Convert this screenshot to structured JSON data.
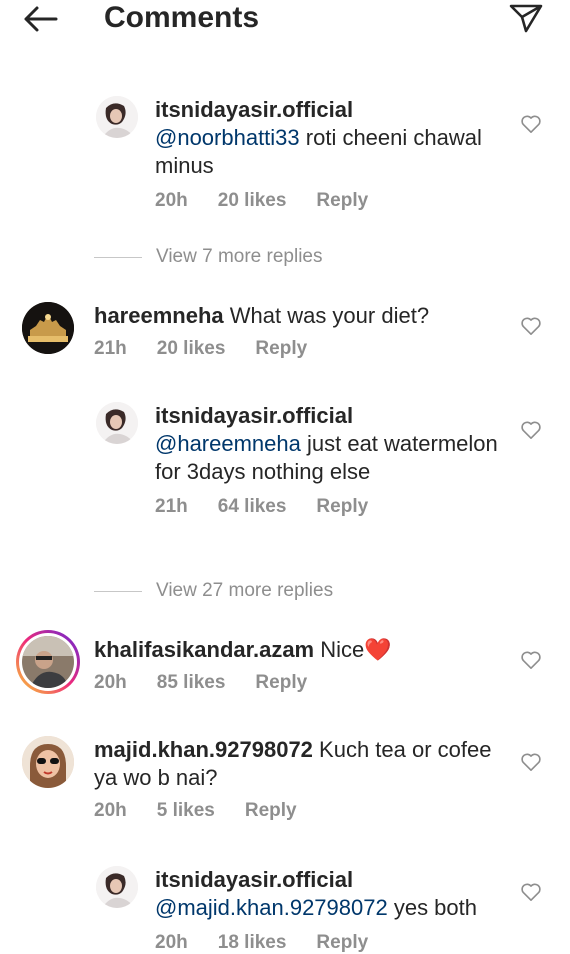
{
  "header": {
    "title": "Comments"
  },
  "comments": [
    {
      "user": "itsnidayasir.official",
      "mention": "@noorbhatti33",
      "text": " roti cheeni chawal minus",
      "time": "20h",
      "likes": "20 likes",
      "reply": "Reply"
    },
    {
      "user": "hareemneha",
      "text": " What was your diet?",
      "time": "21h",
      "likes": "20 likes",
      "reply": "Reply"
    },
    {
      "user": "itsnidayasir.official",
      "mention": "@hareemneha",
      "text": " just eat watermelon for 3days nothing else",
      "time": "21h",
      "likes": "64 likes",
      "reply": "Reply"
    },
    {
      "user": "khalifasikandar.azam",
      "text": " Nice",
      "emoji": "❤️",
      "time": "20h",
      "likes": "85 likes",
      "reply": "Reply"
    },
    {
      "user": "majid.khan.92798072",
      "text": " Kuch tea or cofee ya wo b nai?",
      "time": "20h",
      "likes": "5 likes",
      "reply": "Reply"
    },
    {
      "user": "itsnidayasir.official",
      "mention": "@majid.khan.92798072",
      "text": " yes both",
      "time": "20h",
      "likes": "18 likes",
      "reply": "Reply"
    }
  ],
  "view_more": [
    {
      "label": "View 7 more replies"
    },
    {
      "label": "View 27 more replies"
    }
  ],
  "colors": {
    "text": "#262626",
    "meta": "#8e8e8e",
    "mention": "#00376b",
    "heart": "#ed1c24"
  },
  "icons": {
    "back": "arrow-left-icon",
    "send": "paper-plane-icon",
    "like": "heart-outline-icon"
  }
}
